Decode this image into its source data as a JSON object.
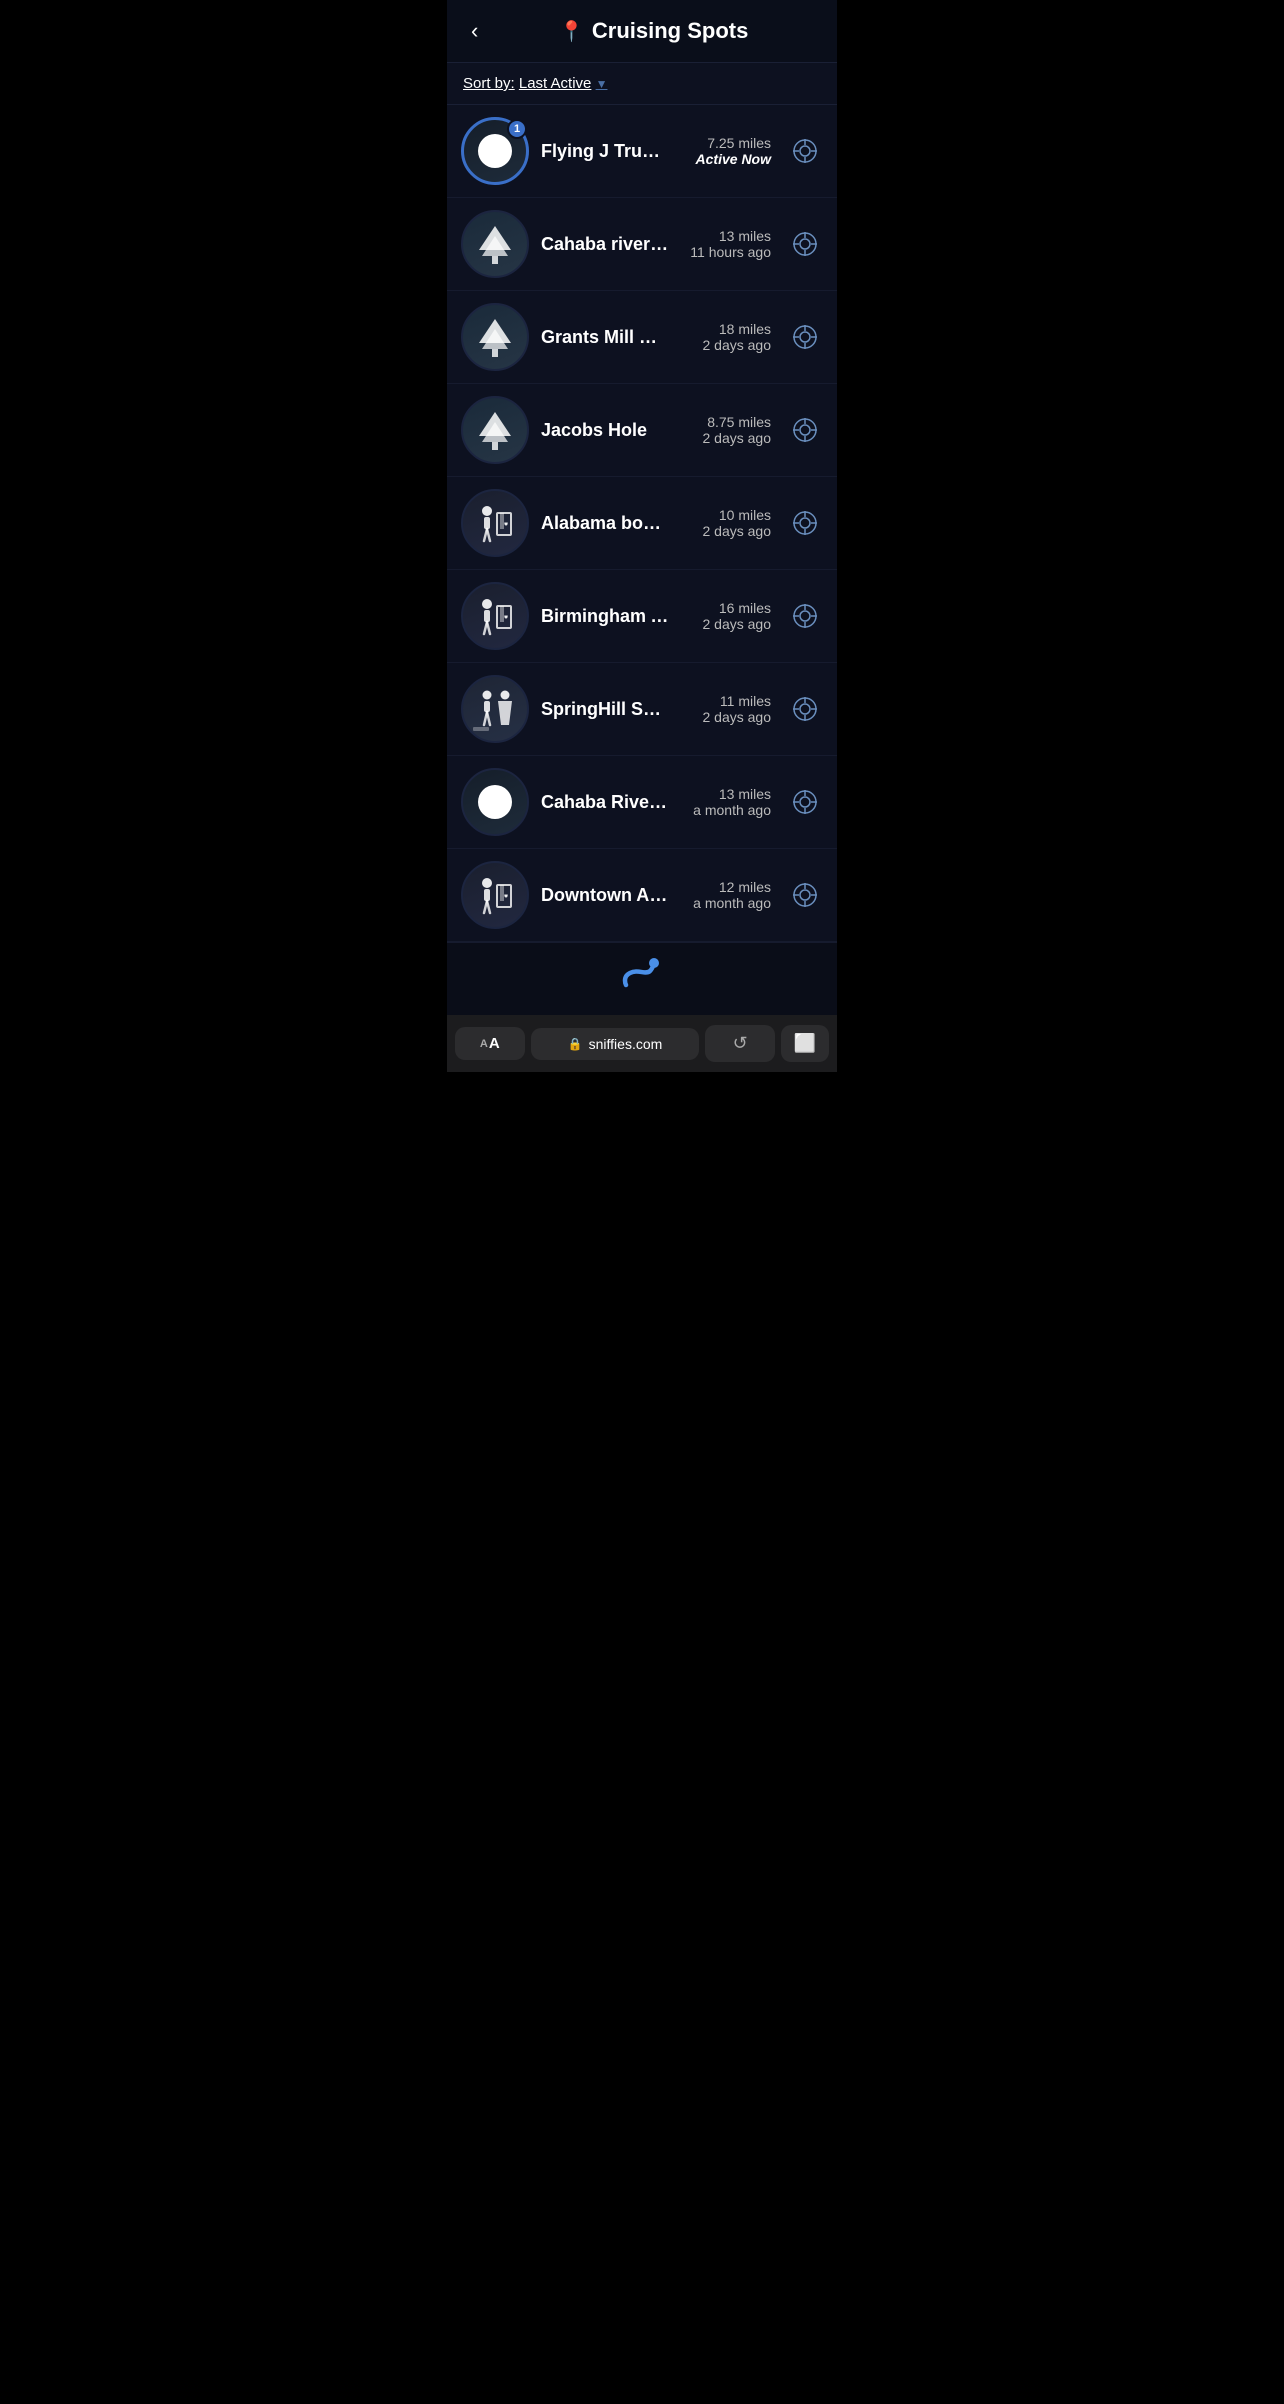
{
  "header": {
    "back_label": "‹",
    "location_icon": "📍",
    "title": "Cruising Spots"
  },
  "sort_bar": {
    "label": "Sort by:",
    "sort_value": "Last Active",
    "arrow": "▼"
  },
  "spots": [
    {
      "id": 1,
      "name": "Flying J Truck Stop",
      "distance": "7.25 miles",
      "time": "Active Now",
      "time_active": true,
      "badge": "1",
      "avatar_type": "circle",
      "has_active_ring": true
    },
    {
      "id": 2,
      "name": "Cahaba river trail",
      "distance": "13 miles",
      "time": "11 hours ago",
      "time_active": false,
      "badge": null,
      "avatar_type": "tree",
      "has_active_ring": false
    },
    {
      "id": 3,
      "name": "Grants Mill Road -Cahaba Riv.",
      "distance": "18 miles",
      "time": "2 days ago",
      "time_active": false,
      "badge": null,
      "avatar_type": "tree",
      "has_active_ring": false
    },
    {
      "id": 4,
      "name": "Jacobs Hole",
      "distance": "8.75 miles",
      "time": "2 days ago",
      "time_active": false,
      "badge": null,
      "avatar_type": "tree",
      "has_active_ring": false
    },
    {
      "id": 5,
      "name": "Alabama books",
      "distance": "10 miles",
      "time": "2 days ago",
      "time_active": false,
      "badge": null,
      "avatar_type": "bookstore",
      "has_active_ring": false
    },
    {
      "id": 6,
      "name": "Birmingham Adult Books",
      "distance": "16 miles",
      "time": "2 days ago",
      "time_active": false,
      "badge": null,
      "avatar_type": "bookstore",
      "has_active_ring": false
    },
    {
      "id": 7,
      "name": "SpringHill Suites Bathroom",
      "distance": "11 miles",
      "time": "2 days ago",
      "time_active": false,
      "badge": null,
      "avatar_type": "bathroom",
      "has_active_ring": false
    },
    {
      "id": 8,
      "name": "Cahaba River Cruise Spot",
      "distance": "13 miles",
      "time": "a month ago",
      "time_active": false,
      "badge": null,
      "avatar_type": "circle",
      "has_active_ring": false
    },
    {
      "id": 9,
      "name": "Downtown Adult Books (Pari...",
      "distance": "12 miles",
      "time": "a month ago",
      "time_active": false,
      "badge": null,
      "avatar_type": "bookstore",
      "has_active_ring": false
    }
  ],
  "brand": {
    "logo": "S"
  },
  "browser": {
    "text_size": "AA",
    "lock_icon": "🔒",
    "url": "sniffies.com",
    "refresh_icon": "↺"
  }
}
